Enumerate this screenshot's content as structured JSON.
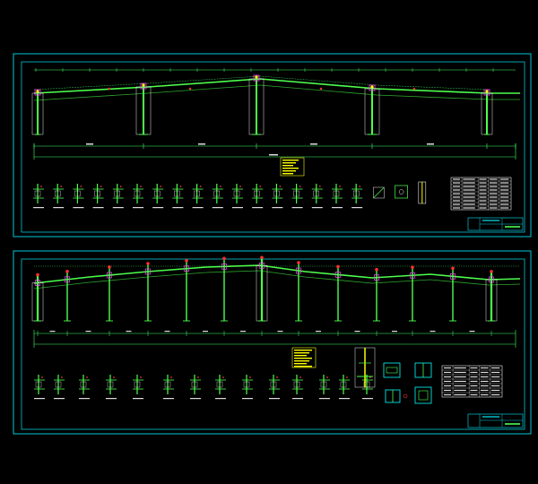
{
  "viewer": {
    "background": "#000000",
    "sheet_border_color": "#00c8d8",
    "colors": {
      "steel": "#4dff4d",
      "steel_dark": "#2ea82e",
      "column_outline": "#e8e8e8",
      "dimension": "#3cff6a",
      "highlight": "#ffff00",
      "bracket": "#ff40ff",
      "marker": "#ff3030",
      "text": "#dcdcdc",
      "title_block": "#00c8d8"
    }
  },
  "drawings": [
    {
      "id": "sheet-1",
      "frame_label": "",
      "columns": 5,
      "detail_count": 20,
      "table_rows": 9,
      "notes_visible": true
    },
    {
      "id": "sheet-2",
      "frame_label": "",
      "columns": 13,
      "detail_count": 15,
      "table_rows": 7,
      "notes_visible": true
    }
  ]
}
